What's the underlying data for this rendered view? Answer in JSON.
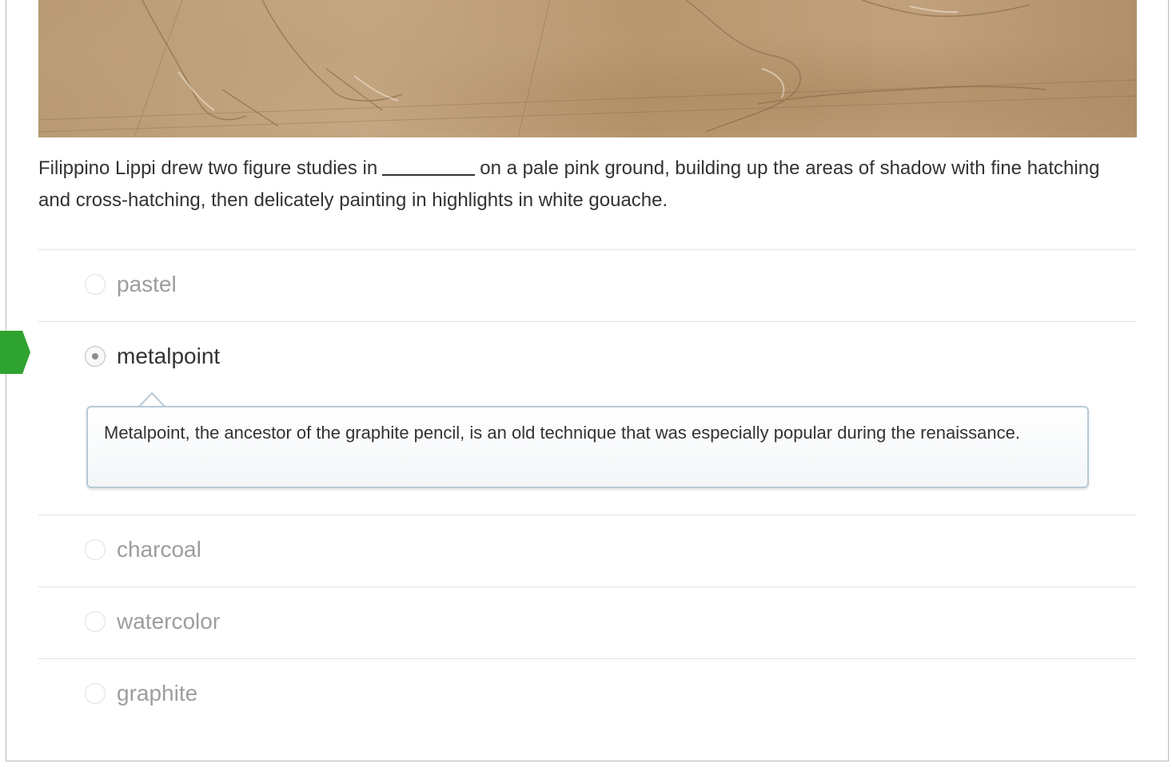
{
  "question": {
    "text_before": "Filippino Lippi drew two figure studies in",
    "blank": "_________",
    "text_after": "on a pale pink ground, building up the areas of shadow with fine hatching and cross-hatching, then delicately painting in highlights in white gouache."
  },
  "choices": [
    {
      "label": "pastel",
      "selected": false
    },
    {
      "label": "metalpoint",
      "selected": true
    },
    {
      "label": "charcoal",
      "selected": false
    },
    {
      "label": "watercolor",
      "selected": false
    },
    {
      "label": "graphite",
      "selected": false
    }
  ],
  "feedback": {
    "text": "Metalpoint, the ancestor of the graphite pencil, is an old technique that was especially popular during the renaissance."
  },
  "colors": {
    "marker": "#2fa32f",
    "selected_text": "#333333",
    "unselected_text": "#9d9d9d",
    "feedback_border": "#b8c9d4"
  },
  "icons": {
    "marker": "progress-marker-icon",
    "radio_selected": "radio-selected-icon",
    "radio_unselected": "radio-unselected-icon"
  }
}
